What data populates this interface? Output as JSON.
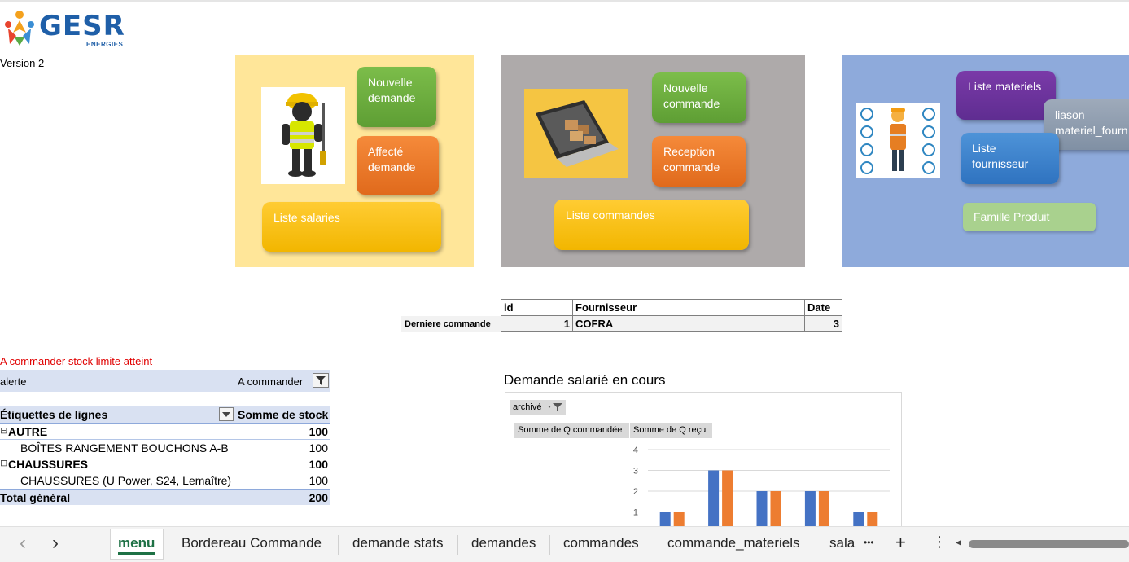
{
  "logo": {
    "name": "GESR",
    "sub": "ENERGIES"
  },
  "version": "Version 2",
  "panels": {
    "salaries": {
      "new_request": "Nouvelle demande",
      "assigned_request": "Affecté demande",
      "list": "Liste salaries"
    },
    "orders": {
      "new_order": "Nouvelle commande",
      "reception": "Reception commande",
      "list": "Liste commandes"
    },
    "materials": {
      "list": "Liste materiels",
      "link": "liason materiel_fourn",
      "suppliers": "Liste fournisseur",
      "family": "Famille Produit"
    }
  },
  "last_order": {
    "label": "Derniere commande",
    "headers": [
      "id",
      "Fournisseur",
      "Date"
    ],
    "row": [
      "1",
      "COFRA",
      "3"
    ]
  },
  "pivot": {
    "note": "A commander stock limite atteint",
    "filter_field": "alerte",
    "filter_value": "A commander",
    "row_header": "Étiquettes de lignes",
    "value_header": "Somme de stock",
    "rows": [
      {
        "label": "AUTRE",
        "value": "100",
        "kind": "group",
        "toggle": "⊟"
      },
      {
        "label": "BOÎTES RANGEMENT BOUCHONS A-B",
        "value": "100",
        "kind": "item"
      },
      {
        "label": "CHAUSSURES",
        "value": "100",
        "kind": "group",
        "toggle": "⊟"
      },
      {
        "label": "CHAUSSURES (U Power, S24, Lemaître)",
        "value": "100",
        "kind": "item"
      },
      {
        "label": "Total général",
        "value": "200",
        "kind": "total"
      }
    ]
  },
  "chart": {
    "title": "Demande salarié en cours",
    "filter_chip": "archivé",
    "legend_buttons": [
      "Somme de Q commandée",
      "Somme de Q reçu"
    ]
  },
  "chart_data": {
    "type": "bar",
    "title": "Demande salarié en cours",
    "series": [
      {
        "name": "Somme de Q commandée",
        "values": [
          1,
          3,
          2,
          2,
          1
        ],
        "color": "#4472c4"
      },
      {
        "name": "Somme de Q reçu",
        "values": [
          1,
          3,
          2,
          2,
          1
        ],
        "color": "#ed7d31"
      }
    ],
    "y_ticks": [
      "1",
      "2",
      "3",
      "4"
    ],
    "ylim": [
      0,
      4
    ],
    "grid": true
  },
  "sheet_tabs": [
    "menu",
    "Bordereau Commande",
    "demande stats",
    "demandes",
    "commandes",
    "commande_materiels",
    "sala"
  ],
  "active_tab": "menu",
  "nav": {
    "prev": "‹",
    "next": "›",
    "more": "•••",
    "add": "+",
    "options": "⋮",
    "scroll_left": "◂"
  },
  "colors": {
    "panel_yellow": "#ffe699",
    "panel_gray": "#aeaaaa",
    "panel_blue": "#8eaadb",
    "header_blue": "#d9e1f2",
    "note_red": "#e00000"
  }
}
